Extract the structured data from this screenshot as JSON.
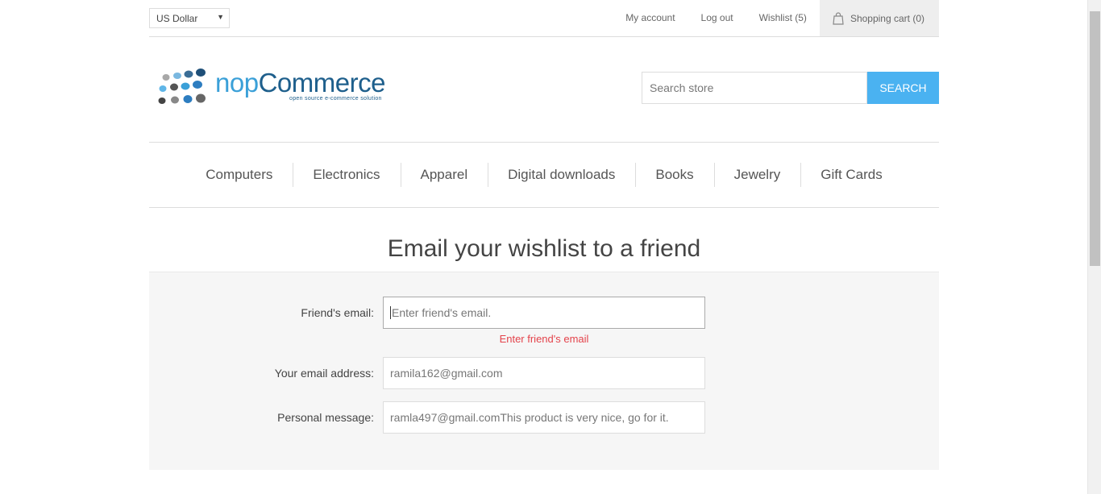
{
  "header": {
    "currency": "US Dollar",
    "links": {
      "my_account": "My account",
      "log_out": "Log out",
      "wishlist": "Wishlist (5)",
      "shopping_cart": "Shopping cart (0)"
    }
  },
  "logo": {
    "name_prefix": "nop",
    "name_suffix": "Commerce",
    "tagline": "open source e-commerce solution"
  },
  "search": {
    "placeholder": "Search store",
    "button_label": "SEARCH"
  },
  "menu": [
    "Computers",
    "Electronics",
    "Apparel",
    "Digital downloads",
    "Books",
    "Jewelry",
    "Gift Cards"
  ],
  "page": {
    "title": "Email your wishlist to a friend"
  },
  "form": {
    "friends_email": {
      "label": "Friend's email:",
      "placeholder": "Enter friend's email.",
      "value": "",
      "error": "Enter friend's email"
    },
    "your_email": {
      "label": "Your email address:",
      "value": "ramila162@gmail.com"
    },
    "personal_message": {
      "label": "Personal message:",
      "value": "ramla497@gmail.comThis product is very nice, go for it."
    }
  },
  "colors": {
    "accent": "#4ab2f1",
    "error": "#e4434b",
    "logo_dark": "#1e5f8c",
    "logo_light": "#3ba0d8"
  }
}
